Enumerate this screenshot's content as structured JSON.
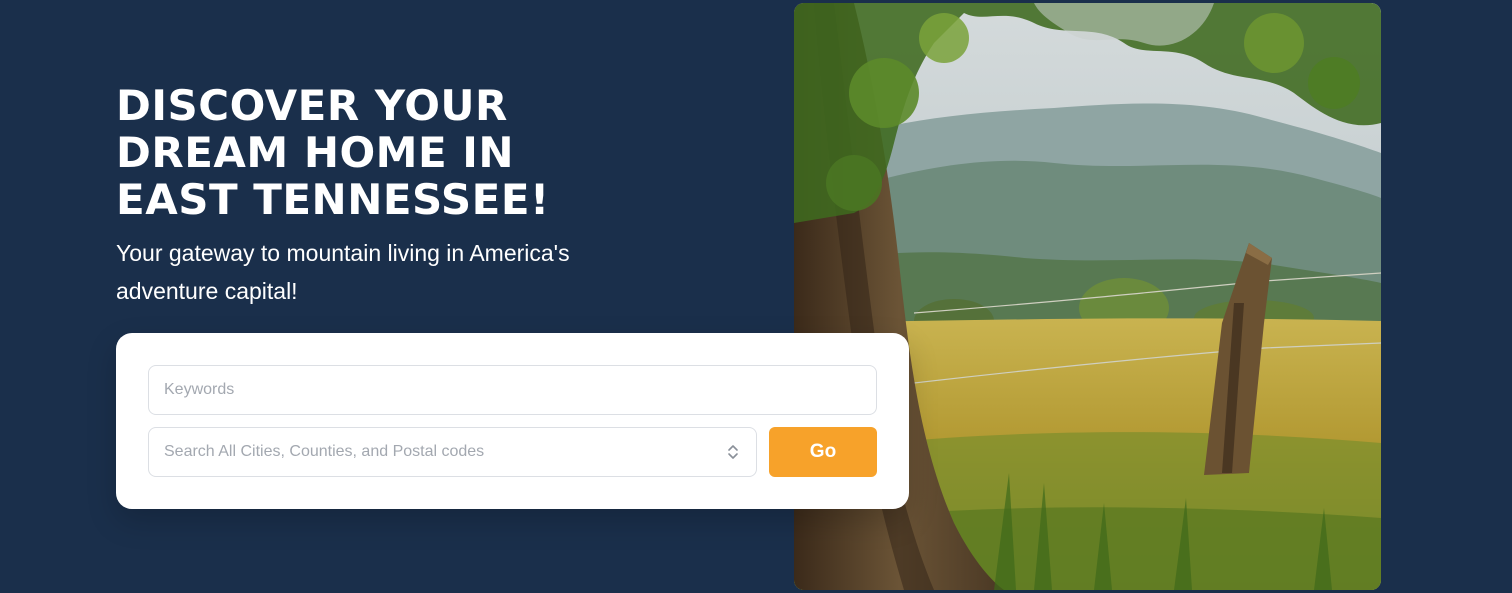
{
  "hero": {
    "headline_lines": [
      "DISCOVER YOUR",
      "DREAM HOME IN",
      "EAST TENNESSEE!"
    ],
    "tagline": "Your gateway to mountain living in America's adventure capital!",
    "background_color": "#1a2f4b"
  },
  "search": {
    "keywords_placeholder": "Keywords",
    "keywords_value": "",
    "location_placeholder": "Search All Cities, Counties, and Postal codes",
    "location_value": "",
    "go_label": "Go",
    "go_color": "#f7a22a",
    "location_icon": "chevron-up-down-icon"
  },
  "photo": {
    "subject": "landscape-photo"
  }
}
